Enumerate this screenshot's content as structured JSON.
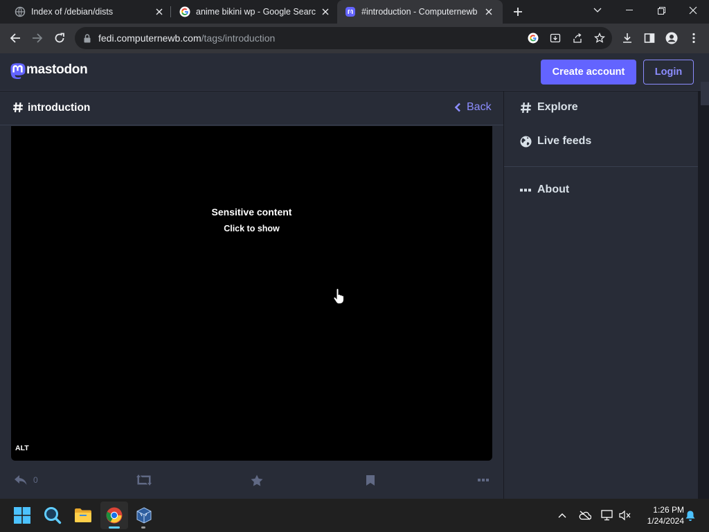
{
  "browser": {
    "tabs": [
      {
        "title": "Index of /debian/dists",
        "active": false
      },
      {
        "title": "anime bikini wp - Google Search",
        "active": false
      },
      {
        "title": "#introduction - Computernewb M",
        "active": true
      }
    ],
    "url_host": "fedi.computernewb.com",
    "url_path": "/tags/introduction"
  },
  "mastodon": {
    "logo_text": "mastodon",
    "create_account_label": "Create account",
    "login_label": "Login",
    "column_title": "introduction",
    "back_label": "Back",
    "media": {
      "spoiler_title": "Sensitive content",
      "spoiler_subtitle": "Click to show",
      "alt_badge": "ALT"
    },
    "actions": {
      "reply_count": "0"
    },
    "nav": [
      {
        "label": "Explore",
        "icon": "hashtag-icon"
      },
      {
        "label": "Live feeds",
        "icon": "globe-icon"
      },
      {
        "label": "About",
        "icon": "ellipsis-icon"
      }
    ]
  },
  "taskbar": {
    "time": "1:26 PM",
    "date": "1/24/2024"
  },
  "colors": {
    "accent": "#6364ff",
    "accent_text": "#8c8dff",
    "background": "#282c37",
    "chrome_bg": "#202124"
  }
}
